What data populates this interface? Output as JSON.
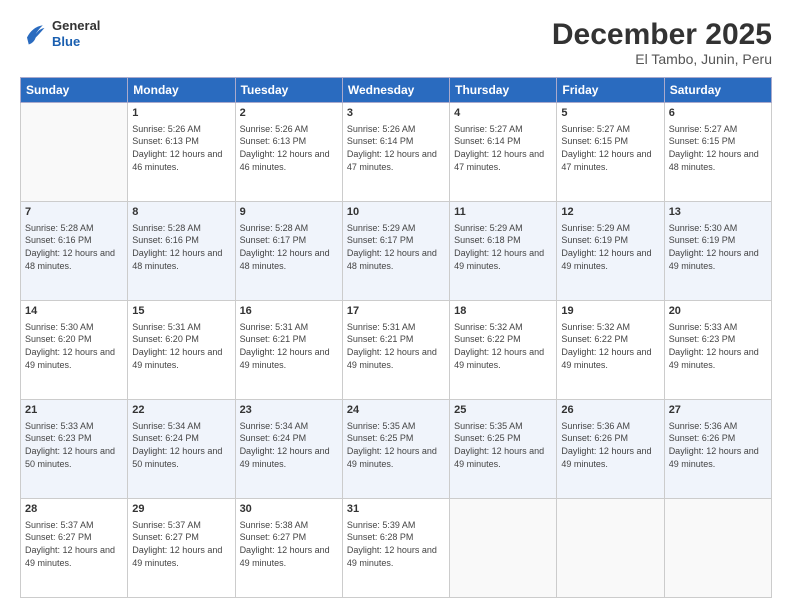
{
  "header": {
    "logo": {
      "line1": "General",
      "line2": "Blue"
    },
    "title": "December 2025",
    "subtitle": "El Tambo, Junin, Peru"
  },
  "weekdays": [
    "Sunday",
    "Monday",
    "Tuesday",
    "Wednesday",
    "Thursday",
    "Friday",
    "Saturday"
  ],
  "weeks": [
    [
      {
        "day": "",
        "sunrise": "",
        "sunset": "",
        "daylight": "",
        "empty": true
      },
      {
        "day": "1",
        "sunrise": "Sunrise: 5:26 AM",
        "sunset": "Sunset: 6:13 PM",
        "daylight": "Daylight: 12 hours and 46 minutes."
      },
      {
        "day": "2",
        "sunrise": "Sunrise: 5:26 AM",
        "sunset": "Sunset: 6:13 PM",
        "daylight": "Daylight: 12 hours and 46 minutes."
      },
      {
        "day": "3",
        "sunrise": "Sunrise: 5:26 AM",
        "sunset": "Sunset: 6:14 PM",
        "daylight": "Daylight: 12 hours and 47 minutes."
      },
      {
        "day": "4",
        "sunrise": "Sunrise: 5:27 AM",
        "sunset": "Sunset: 6:14 PM",
        "daylight": "Daylight: 12 hours and 47 minutes."
      },
      {
        "day": "5",
        "sunrise": "Sunrise: 5:27 AM",
        "sunset": "Sunset: 6:15 PM",
        "daylight": "Daylight: 12 hours and 47 minutes."
      },
      {
        "day": "6",
        "sunrise": "Sunrise: 5:27 AM",
        "sunset": "Sunset: 6:15 PM",
        "daylight": "Daylight: 12 hours and 48 minutes."
      }
    ],
    [
      {
        "day": "7",
        "sunrise": "Sunrise: 5:28 AM",
        "sunset": "Sunset: 6:16 PM",
        "daylight": "Daylight: 12 hours and 48 minutes."
      },
      {
        "day": "8",
        "sunrise": "Sunrise: 5:28 AM",
        "sunset": "Sunset: 6:16 PM",
        "daylight": "Daylight: 12 hours and 48 minutes."
      },
      {
        "day": "9",
        "sunrise": "Sunrise: 5:28 AM",
        "sunset": "Sunset: 6:17 PM",
        "daylight": "Daylight: 12 hours and 48 minutes."
      },
      {
        "day": "10",
        "sunrise": "Sunrise: 5:29 AM",
        "sunset": "Sunset: 6:17 PM",
        "daylight": "Daylight: 12 hours and 48 minutes."
      },
      {
        "day": "11",
        "sunrise": "Sunrise: 5:29 AM",
        "sunset": "Sunset: 6:18 PM",
        "daylight": "Daylight: 12 hours and 49 minutes."
      },
      {
        "day": "12",
        "sunrise": "Sunrise: 5:29 AM",
        "sunset": "Sunset: 6:19 PM",
        "daylight": "Daylight: 12 hours and 49 minutes."
      },
      {
        "day": "13",
        "sunrise": "Sunrise: 5:30 AM",
        "sunset": "Sunset: 6:19 PM",
        "daylight": "Daylight: 12 hours and 49 minutes."
      }
    ],
    [
      {
        "day": "14",
        "sunrise": "Sunrise: 5:30 AM",
        "sunset": "Sunset: 6:20 PM",
        "daylight": "Daylight: 12 hours and 49 minutes."
      },
      {
        "day": "15",
        "sunrise": "Sunrise: 5:31 AM",
        "sunset": "Sunset: 6:20 PM",
        "daylight": "Daylight: 12 hours and 49 minutes."
      },
      {
        "day": "16",
        "sunrise": "Sunrise: 5:31 AM",
        "sunset": "Sunset: 6:21 PM",
        "daylight": "Daylight: 12 hours and 49 minutes."
      },
      {
        "day": "17",
        "sunrise": "Sunrise: 5:31 AM",
        "sunset": "Sunset: 6:21 PM",
        "daylight": "Daylight: 12 hours and 49 minutes."
      },
      {
        "day": "18",
        "sunrise": "Sunrise: 5:32 AM",
        "sunset": "Sunset: 6:22 PM",
        "daylight": "Daylight: 12 hours and 49 minutes."
      },
      {
        "day": "19",
        "sunrise": "Sunrise: 5:32 AM",
        "sunset": "Sunset: 6:22 PM",
        "daylight": "Daylight: 12 hours and 49 minutes."
      },
      {
        "day": "20",
        "sunrise": "Sunrise: 5:33 AM",
        "sunset": "Sunset: 6:23 PM",
        "daylight": "Daylight: 12 hours and 49 minutes."
      }
    ],
    [
      {
        "day": "21",
        "sunrise": "Sunrise: 5:33 AM",
        "sunset": "Sunset: 6:23 PM",
        "daylight": "Daylight: 12 hours and 50 minutes."
      },
      {
        "day": "22",
        "sunrise": "Sunrise: 5:34 AM",
        "sunset": "Sunset: 6:24 PM",
        "daylight": "Daylight: 12 hours and 50 minutes."
      },
      {
        "day": "23",
        "sunrise": "Sunrise: 5:34 AM",
        "sunset": "Sunset: 6:24 PM",
        "daylight": "Daylight: 12 hours and 49 minutes."
      },
      {
        "day": "24",
        "sunrise": "Sunrise: 5:35 AM",
        "sunset": "Sunset: 6:25 PM",
        "daylight": "Daylight: 12 hours and 49 minutes."
      },
      {
        "day": "25",
        "sunrise": "Sunrise: 5:35 AM",
        "sunset": "Sunset: 6:25 PM",
        "daylight": "Daylight: 12 hours and 49 minutes."
      },
      {
        "day": "26",
        "sunrise": "Sunrise: 5:36 AM",
        "sunset": "Sunset: 6:26 PM",
        "daylight": "Daylight: 12 hours and 49 minutes."
      },
      {
        "day": "27",
        "sunrise": "Sunrise: 5:36 AM",
        "sunset": "Sunset: 6:26 PM",
        "daylight": "Daylight: 12 hours and 49 minutes."
      }
    ],
    [
      {
        "day": "28",
        "sunrise": "Sunrise: 5:37 AM",
        "sunset": "Sunset: 6:27 PM",
        "daylight": "Daylight: 12 hours and 49 minutes."
      },
      {
        "day": "29",
        "sunrise": "Sunrise: 5:37 AM",
        "sunset": "Sunset: 6:27 PM",
        "daylight": "Daylight: 12 hours and 49 minutes."
      },
      {
        "day": "30",
        "sunrise": "Sunrise: 5:38 AM",
        "sunset": "Sunset: 6:27 PM",
        "daylight": "Daylight: 12 hours and 49 minutes."
      },
      {
        "day": "31",
        "sunrise": "Sunrise: 5:39 AM",
        "sunset": "Sunset: 6:28 PM",
        "daylight": "Daylight: 12 hours and 49 minutes."
      },
      {
        "day": "",
        "sunrise": "",
        "sunset": "",
        "daylight": "",
        "empty": true
      },
      {
        "day": "",
        "sunrise": "",
        "sunset": "",
        "daylight": "",
        "empty": true
      },
      {
        "day": "",
        "sunrise": "",
        "sunset": "",
        "daylight": "",
        "empty": true
      }
    ]
  ]
}
